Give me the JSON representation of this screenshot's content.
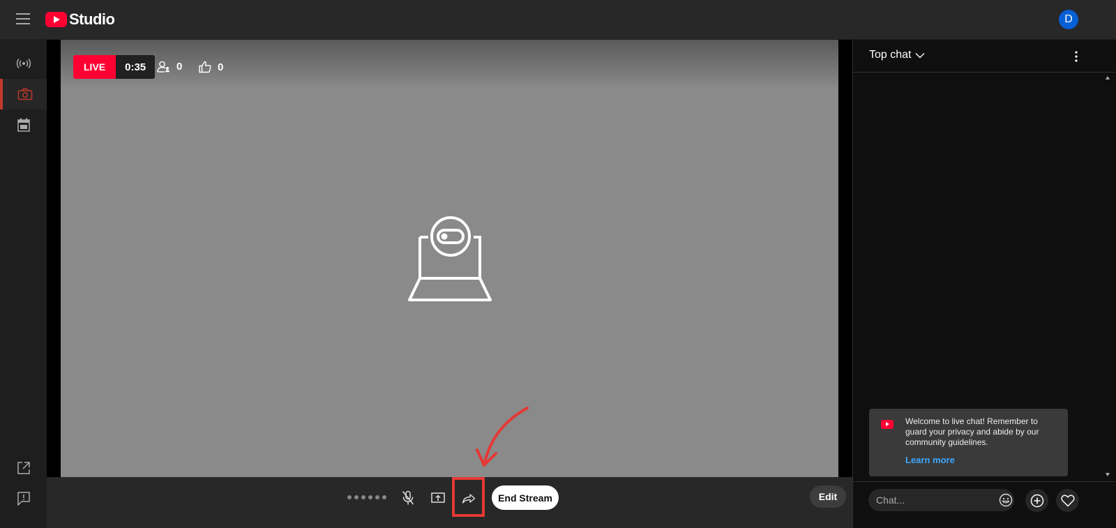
{
  "header": {
    "logo_text": "Studio",
    "avatar_initial": "D"
  },
  "stream": {
    "live_label": "LIVE",
    "elapsed": "0:35",
    "viewers": "0",
    "likes": "0"
  },
  "controls": {
    "end_stream_label": "End Stream",
    "edit_label": "Edit"
  },
  "chat": {
    "title": "Top chat",
    "welcome_text": "Welcome to live chat! Remember to guard your privacy and abide by our community guidelines.",
    "learn_more": "Learn more",
    "input_placeholder": "Chat..."
  },
  "colors": {
    "brand_red": "#ff0033",
    "link_blue": "#3ea6ff",
    "avatar_blue": "#065fd4",
    "highlight": "#e53935"
  },
  "icons": [
    "hamburger-icon",
    "live-broadcast-icon",
    "camera-icon",
    "calendar-icon",
    "external-link-icon",
    "feedback-icon",
    "viewers-icon",
    "thumbs-up-icon",
    "webcam-off-icon",
    "mic-off-icon",
    "screen-share-icon",
    "share-arrow-icon",
    "chevron-down-icon",
    "more-vert-icon",
    "emoji-icon",
    "add-icon",
    "heart-icon"
  ]
}
